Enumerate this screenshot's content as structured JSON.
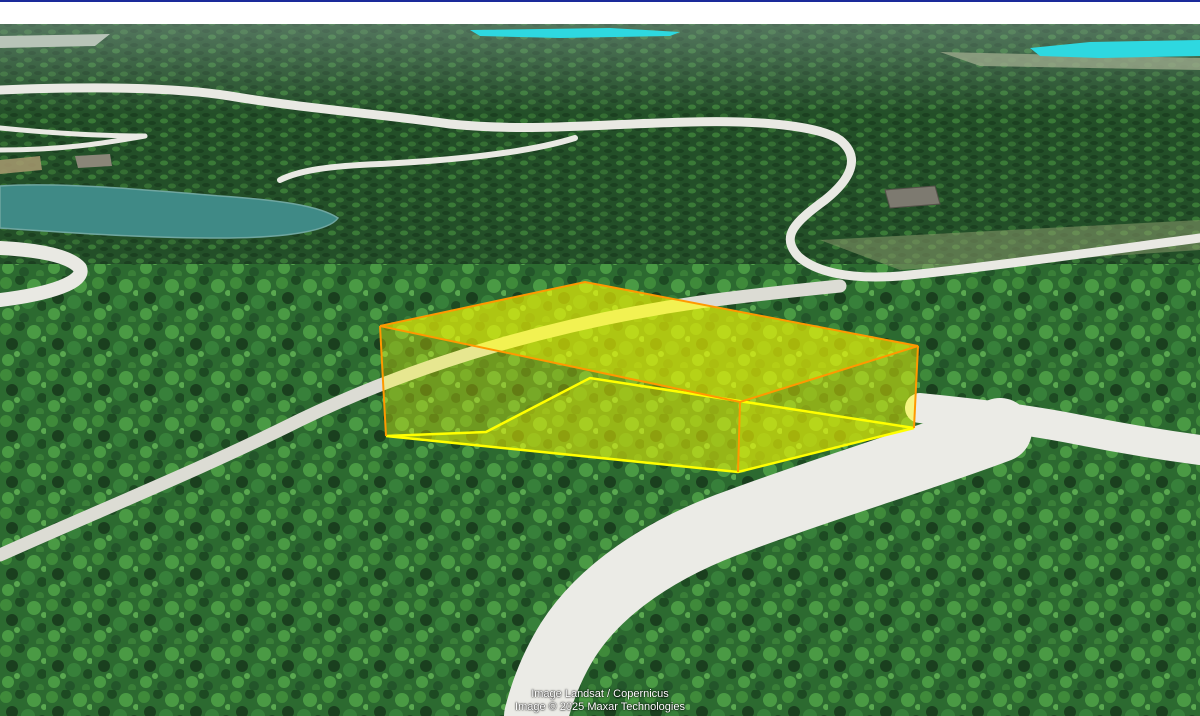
{
  "map": {
    "view": "3d-satellite",
    "highlight": {
      "shape": "extruded-parcel-box",
      "fill_color": "#ffff00",
      "edge_color": "#ff9900"
    },
    "colors": {
      "forest_dark": "#1d4a22",
      "forest_light": "#3f8a3a",
      "water": "#3f8a86",
      "pool": "#2ed8e0",
      "road": "#e9e9e3",
      "header_border": "#1a2a9a"
    }
  },
  "attribution": {
    "line1": "Image Landsat / Copernicus",
    "line2": "Image © 2025 Maxar Technologies"
  }
}
